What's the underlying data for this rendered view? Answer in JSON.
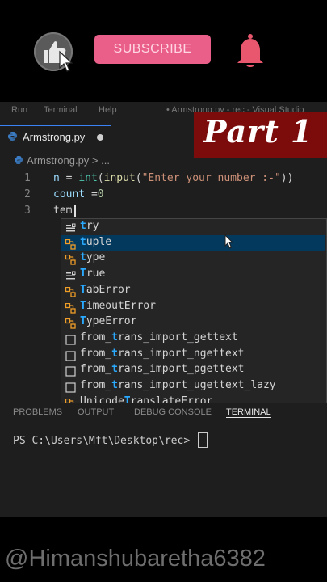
{
  "promo": {
    "subscribe_label": "SUBSCRIBE"
  },
  "menubar": {
    "items": [
      "Run",
      "Terminal",
      "Help"
    ],
    "title": "• Armstrong.py - rec - Visual Studio"
  },
  "overlay": {
    "part_label": "Part 1"
  },
  "editor": {
    "tab_label": "Armstrong.py",
    "breadcrumb": "Armstrong.py > ...",
    "line_numbers": [
      "1",
      "2",
      "3"
    ],
    "lines": [
      {
        "var": "n",
        "eq": " = ",
        "call1": "int",
        "p1": "(",
        "call2": "input",
        "p2": "(",
        "str": "\"Enter your number :-\"",
        "close": "))"
      },
      {
        "var": "count",
        "eq": " =",
        "num": "0"
      },
      {
        "text": "tem"
      }
    ]
  },
  "suggestions": [
    {
      "kind": "keyword",
      "match": "t",
      "rest": "ry"
    },
    {
      "kind": "class",
      "match": "t",
      "rest": "uple",
      "selected": true
    },
    {
      "kind": "class",
      "match": "t",
      "rest": "ype"
    },
    {
      "kind": "keyword",
      "match": "T",
      "rest": "rue"
    },
    {
      "kind": "class",
      "match": "T",
      "rest": "abError"
    },
    {
      "kind": "class",
      "match": "T",
      "rest": "imeoutError"
    },
    {
      "kind": "class",
      "match": "T",
      "rest": "ypeError"
    },
    {
      "kind": "module",
      "pre": "from_",
      "match": "t",
      "rest": "rans_import_gettext"
    },
    {
      "kind": "module",
      "pre": "from_",
      "match": "t",
      "rest": "rans_import_ngettext"
    },
    {
      "kind": "module",
      "pre": "from_",
      "match": "t",
      "rest": "rans_import_pgettext"
    },
    {
      "kind": "module",
      "pre": "from_",
      "match": "t",
      "rest": "rans_import_ugettext_lazy"
    },
    {
      "kind": "class",
      "pre": "Unicode",
      "match": "T",
      "rest": "ranslateError"
    }
  ],
  "panel": {
    "tabs": [
      "PROBLEMS",
      "OUTPUT",
      "DEBUG CONSOLE",
      "TERMINAL"
    ],
    "active_tab": "TERMINAL",
    "prompt": "PS C:\\Users\\Mft\\Desktop\\rec> "
  },
  "watermark": "@Himanshubaretha6382",
  "colors": {
    "subscribe": "#ea5f8a",
    "bell": "#e8576d",
    "overlay": "#7c0b0b",
    "selection": "#04395e",
    "match": "#2aaaff"
  }
}
